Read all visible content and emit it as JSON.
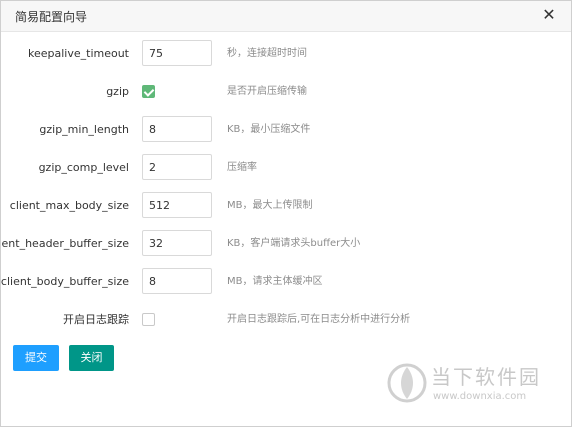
{
  "dialog": {
    "title": "简易配置向导",
    "close_icon": "close-icon"
  },
  "fields": {
    "keepalive_timeout": {
      "label": "keepalive_timeout",
      "value": "75",
      "hint": "秒，连接超时时间"
    },
    "gzip": {
      "label": "gzip",
      "checked": true,
      "hint": "是否开启压缩传输"
    },
    "gzip_min_length": {
      "label": "gzip_min_length",
      "value": "8",
      "hint": "KB，最小压缩文件"
    },
    "gzip_comp_level": {
      "label": "gzip_comp_level",
      "value": "2",
      "hint": "压缩率"
    },
    "client_max_body_size": {
      "label": "client_max_body_size",
      "value": "512",
      "hint": "MB，最大上传限制"
    },
    "client_header_buffer_size": {
      "label": "client_header_buffer_size",
      "value": "32",
      "hint": "KB，客户端请求头buffer大小"
    },
    "client_body_buffer_size": {
      "label": "client_body_buffer_size",
      "value": "8",
      "hint": "MB，请求主体缓冲区"
    },
    "log_tracking": {
      "label": "开启日志跟踪",
      "checked": false,
      "hint": "开启日志跟踪后,可在日志分析中进行分析"
    }
  },
  "buttons": {
    "submit_label": "提交",
    "close_label": "关闭",
    "submit_color": "#1E9FFF",
    "close_color": "#009688"
  },
  "watermark": {
    "name": "当下软件园",
    "url": "www.downxia.com"
  }
}
